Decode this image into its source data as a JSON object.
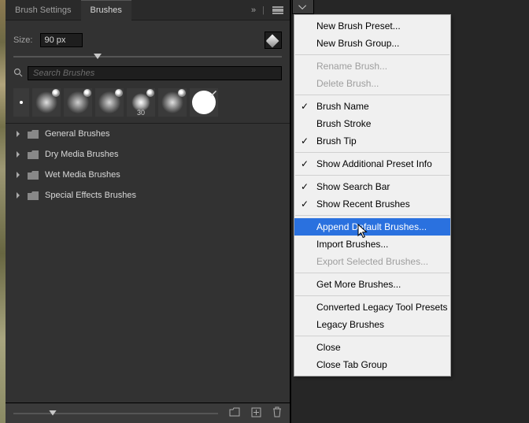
{
  "tabs": [
    {
      "label": "Brush Settings",
      "active": false
    },
    {
      "label": "Brushes",
      "active": true
    }
  ],
  "size": {
    "label": "Size:",
    "value": "90 px"
  },
  "search": {
    "placeholder": "Search Brushes"
  },
  "recent": [
    {
      "size": ""
    },
    {
      "size": ""
    },
    {
      "size": ""
    },
    {
      "size": ""
    },
    {
      "size": "30"
    },
    {
      "size": ""
    },
    {
      "size": ""
    }
  ],
  "folders": [
    {
      "name": "General Brushes"
    },
    {
      "name": "Dry Media Brushes"
    },
    {
      "name": "Wet Media Brushes"
    },
    {
      "name": "Special Effects Brushes"
    }
  ],
  "menu": [
    {
      "type": "item",
      "label": "New Brush Preset..."
    },
    {
      "type": "item",
      "label": "New Brush Group..."
    },
    {
      "type": "sep"
    },
    {
      "type": "item",
      "label": "Rename Brush...",
      "disabled": true
    },
    {
      "type": "item",
      "label": "Delete Brush...",
      "disabled": true
    },
    {
      "type": "sep"
    },
    {
      "type": "item",
      "label": "Brush Name",
      "checked": true
    },
    {
      "type": "item",
      "label": "Brush Stroke"
    },
    {
      "type": "item",
      "label": "Brush Tip",
      "checked": true
    },
    {
      "type": "sep"
    },
    {
      "type": "item",
      "label": "Show Additional Preset Info",
      "checked": true
    },
    {
      "type": "sep"
    },
    {
      "type": "item",
      "label": "Show Search Bar",
      "checked": true
    },
    {
      "type": "item",
      "label": "Show Recent Brushes",
      "checked": true
    },
    {
      "type": "sep"
    },
    {
      "type": "item",
      "label": "Append Default Brushes...",
      "hovered": true
    },
    {
      "type": "item",
      "label": "Import Brushes..."
    },
    {
      "type": "item",
      "label": "Export Selected Brushes...",
      "disabled": true
    },
    {
      "type": "sep"
    },
    {
      "type": "item",
      "label": "Get More Brushes..."
    },
    {
      "type": "sep"
    },
    {
      "type": "item",
      "label": "Converted Legacy Tool Presets"
    },
    {
      "type": "item",
      "label": "Legacy Brushes"
    },
    {
      "type": "sep"
    },
    {
      "type": "item",
      "label": "Close"
    },
    {
      "type": "item",
      "label": "Close Tab Group"
    }
  ]
}
